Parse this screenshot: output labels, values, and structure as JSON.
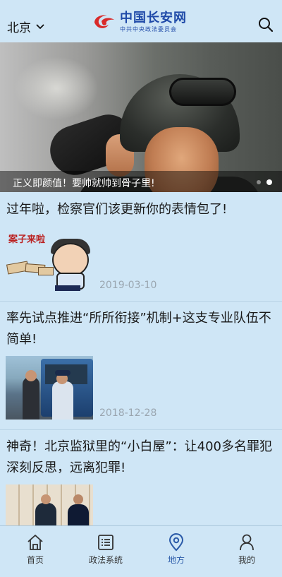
{
  "header": {
    "city": "北京",
    "logo_title": "中国长安网",
    "logo_subtitle": "中共中央政法委员会"
  },
  "banner": {
    "caption": "正义即颜值！要帅就帅到骨子里!"
  },
  "articles": [
    {
      "title": "过年啦，检察官们该更新你的表情包了!",
      "date": "2019-03-10",
      "thumb_text": "案子来啦"
    },
    {
      "title": "率先试点推进“所所衔接”机制+这支专业队伍不简单!",
      "date": "2018-12-28"
    },
    {
      "title": "神奇！北京监狱里的“小白屋”：让400多名罪犯深刻反思，远离犯罪!"
    }
  ],
  "tabs": [
    {
      "label": "首页",
      "icon": "home-icon"
    },
    {
      "label": "政法系统",
      "icon": "list-icon"
    },
    {
      "label": "地方",
      "icon": "location-pin-icon",
      "active": true
    },
    {
      "label": "我的",
      "icon": "user-icon"
    }
  ],
  "colors": {
    "background": "#cfe6f6",
    "brand_blue": "#1f4aa8",
    "brand_red": "#d92a2a",
    "active_tab": "#2a5aa8"
  }
}
